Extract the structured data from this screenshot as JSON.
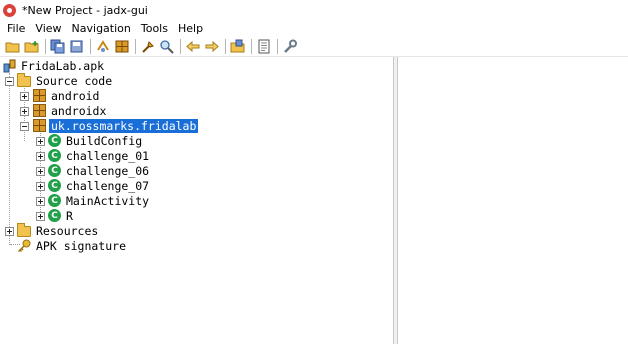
{
  "window": {
    "title": "*New Project - jadx-gui"
  },
  "menu": [
    "File",
    "View",
    "Navigation",
    "Tools",
    "Help"
  ],
  "toolbar": {
    "groups": [
      [
        "open-file-icon",
        "add-files-icon"
      ],
      [
        "save-all-icon",
        "export-icon"
      ],
      [
        "sync-icon",
        "flatten-packages-icon"
      ],
      [
        "search-text-icon",
        "find-class-icon"
      ],
      [
        "back-icon",
        "forward-icon"
      ],
      [
        "deobfuscation-icon"
      ],
      [
        "log-viewer-icon"
      ],
      [
        "preferences-icon"
      ]
    ]
  },
  "tree": {
    "root": "FridaLab.apk",
    "source_code": "Source code",
    "packages": [
      "android",
      "androidx",
      "uk.rossmarks.fridalab"
    ],
    "classes": [
      "BuildConfig",
      "challenge_01",
      "challenge_06",
      "challenge_07",
      "MainActivity",
      "R"
    ],
    "resources": "Resources",
    "apk_signature": "APK signature",
    "class_glyph": "C"
  },
  "colors": {
    "selection": "#1a6ed8",
    "class_icon": "#21a04a",
    "package_icon": "#d99a2b"
  }
}
